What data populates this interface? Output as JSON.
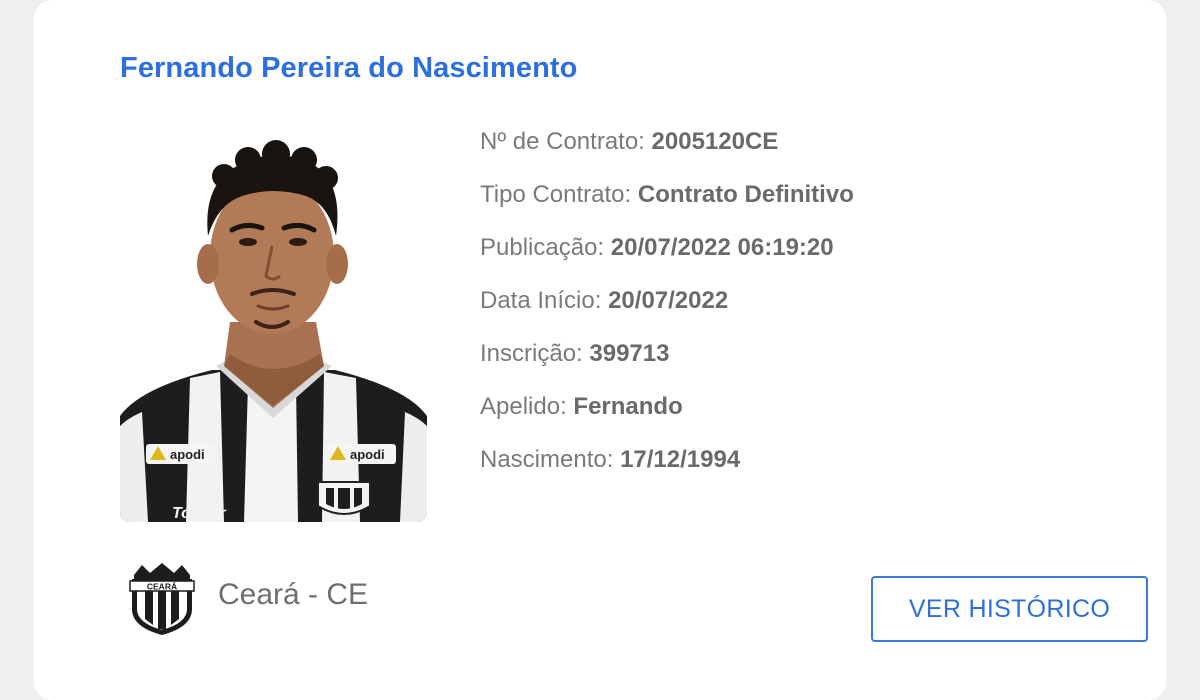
{
  "player": {
    "name": "Fernando Pereira do Nascimento"
  },
  "details": {
    "contract_number_label": "Nº de Contrato:",
    "contract_number": "2005120CE",
    "contract_type_label": "Tipo Contrato:",
    "contract_type": "Contrato Definitivo",
    "publication_label": "Publicação:",
    "publication": "20/07/2022 06:19:20",
    "start_date_label": "Data Início:",
    "start_date": "20/07/2022",
    "registration_label": "Inscrição:",
    "registration": "399713",
    "nickname_label": "Apelido:",
    "nickname": "Fernando",
    "birth_label": "Nascimento:",
    "birth": "17/12/1994"
  },
  "club": {
    "name": "Ceará - CE"
  },
  "actions": {
    "history_label": "VER HISTÓRICO"
  },
  "photo": {
    "shirt_sponsor": "apodi",
    "shirt_brand": "Topper",
    "crest_text": "CEARÁ"
  },
  "colors": {
    "accent": "#2d6fe0",
    "label_text": "#7a7a7a",
    "value_text": "#6a6a6a",
    "card_bg": "#ffffff",
    "page_bg": "#efefef"
  }
}
